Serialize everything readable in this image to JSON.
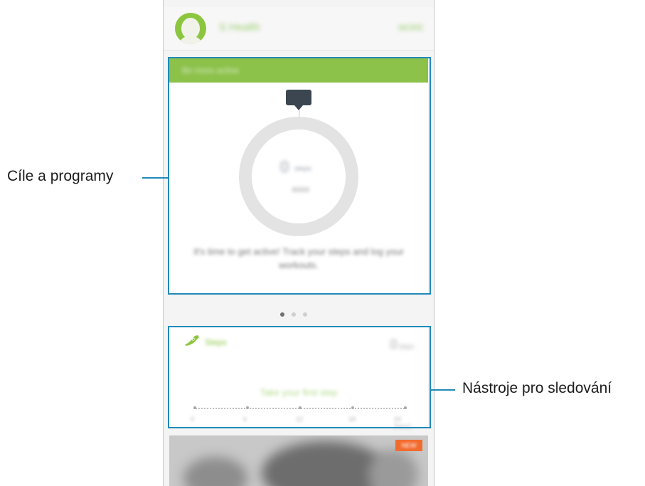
{
  "app": {
    "title": "S Health",
    "top_action": "MORE"
  },
  "goals_card": {
    "header": "Be more active",
    "steps_value": "0",
    "steps_unit": "steps",
    "steps_goal": "/6000",
    "message": "It's time to get active! Track your steps and log your workouts."
  },
  "pager": {
    "page_count": 3,
    "active_index": 0
  },
  "tracker_card": {
    "title": "Steps",
    "count_value": "0",
    "count_unit": "steps",
    "message": "Take your first step",
    "timeline_labels": [
      "0",
      "6",
      "12",
      "18",
      "24 (hour)"
    ]
  },
  "promo_card": {
    "badge": "NEW"
  },
  "callouts": {
    "left_label": "Cíle a programy",
    "right_label": "Nástroje pro sledování"
  },
  "colors": {
    "accent_green": "#8cc14a",
    "callout_blue": "#1f8ab8",
    "badge_orange": "#f26b2e"
  }
}
